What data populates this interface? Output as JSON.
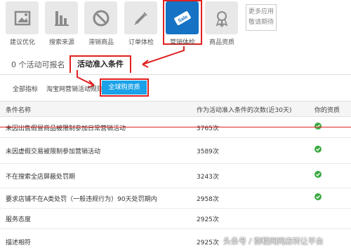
{
  "apps": [
    {
      "label": "建议优化",
      "icon": "image-icon"
    },
    {
      "label": "搜索来源",
      "icon": "bar-chart-icon"
    },
    {
      "label": "滞销商品",
      "icon": "no-sign-icon"
    },
    {
      "label": "订单体检",
      "icon": "syringe-icon"
    },
    {
      "label": "营销体检",
      "icon": "sale-tag-icon",
      "badge": "Sale"
    },
    {
      "label": "商品资质",
      "icon": "ribbon-award-icon"
    }
  ],
  "more_apps": {
    "line1": "更多应用",
    "line2": "敬请期待"
  },
  "tabs": {
    "count_tab": "0 个活动可报名",
    "condition_tab": "活动准入条件"
  },
  "filters": {
    "all": "全部指标",
    "taobao": "淘宝网营销活动规则",
    "global": "全球购资质"
  },
  "table": {
    "headers": {
      "name": "条件名称",
      "times": "作为活动准入条件的次数(近30天)",
      "qualification": "你的资质"
    },
    "rows": [
      {
        "name": "未因出售假冒商品被限制参加日常营销活动",
        "times": "3765次",
        "ok": true
      },
      {
        "name": "未因虚假交易被限制参加营销活动",
        "times": "3589次",
        "ok": true
      },
      {
        "name": "不在搜索全店屏蔽处罚期",
        "times": "3243次",
        "ok": true
      },
      {
        "name": "要求店铺不在A类处罚（一般违规行为）90天处罚期内",
        "times": "2958次",
        "ok": true
      },
      {
        "name": "服务态度",
        "times": "2925次",
        "ok": false
      },
      {
        "name": "描述相符",
        "times": "2925次",
        "ok": false
      }
    ]
  },
  "watermark": "头条号 / 御程网网店转让平台",
  "colors": {
    "accent_red": "#e02020",
    "active_blue": "#1572c4",
    "filter_blue": "#1aa1e8",
    "check_green": "#3aa940"
  }
}
